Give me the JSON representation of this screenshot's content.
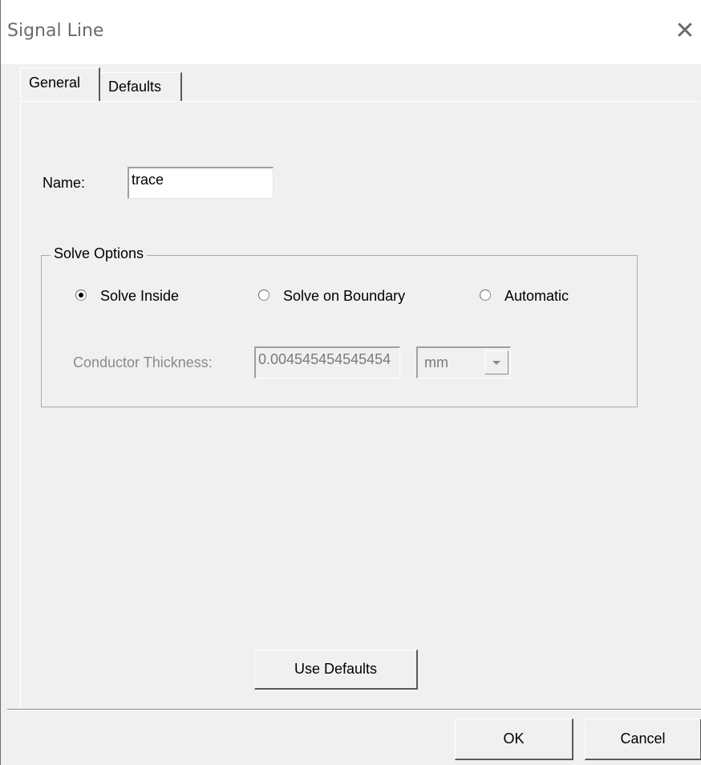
{
  "window": {
    "title": "Signal Line",
    "close_icon": "close-icon"
  },
  "tabs": [
    {
      "label": "General",
      "active": true
    },
    {
      "label": "Defaults",
      "active": false
    }
  ],
  "general": {
    "name_label": "Name:",
    "name_value": "trace",
    "solve_options": {
      "legend": "Solve Options",
      "radios": [
        {
          "label": "Solve Inside",
          "checked": true
        },
        {
          "label": "Solve on Boundary",
          "checked": false
        },
        {
          "label": "Automatic",
          "checked": false
        }
      ],
      "thickness_label": "Conductor Thickness:",
      "thickness_value": "0.004545454545454",
      "thickness_unit": "mm"
    },
    "use_defaults_label": "Use Defaults"
  },
  "footer": {
    "ok_label": "OK",
    "cancel_label": "Cancel"
  }
}
